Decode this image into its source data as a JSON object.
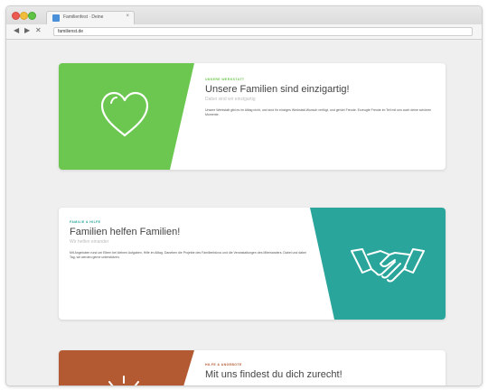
{
  "browser": {
    "tab_title": "Familienfest · Deine",
    "tab_close": "×",
    "url": "familienst.de",
    "nav": {
      "back": "◀",
      "forward": "▶",
      "reload": "✕"
    }
  },
  "sections": [
    {
      "eyebrow": "Unsere Werkstatt",
      "title": "Unsere Familien sind einzigartig!",
      "subtitle": "Dabei sind wir einzigartig",
      "body": "Unsere Werkstatt gibt es im Alltag nicht, und sind Ihr einziges Werkstatt-Wunsch verfügt, und gehört Freude. Erzeugte Freude im Teil mit uns auch deine schönen Momente.",
      "icon": "heart-icon",
      "color": "#6cc750"
    },
    {
      "eyebrow": "Familie & Hilfe",
      "title": "Familien helfen Familien!",
      "subtitle": "Wir helfen einander",
      "body": "Mit Angeboten rund um Eltern bei kleinen Aufgaben, Hilfe im Alltag. Daneben die Projekte des Familienbüros und die Veranstaltungen des Miteinanders. Dabei und dabei Tag, wir werden gerne unterstützen.",
      "icon": "handshake-icon",
      "color": "#2aa59b"
    },
    {
      "eyebrow": "Hilfe & Angebote",
      "title": "Mit uns findest du dich zurecht!",
      "icon": "sun-icon",
      "color": "#b45a33"
    }
  ]
}
